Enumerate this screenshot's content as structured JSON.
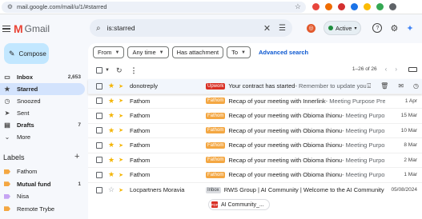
{
  "browser": {
    "url": "mail.google.com/mail/u/1/#starred",
    "ext_colors": [
      "#e8453c",
      "#ef6c00",
      "#d32f2f",
      "#1a73e8",
      "#fbbc04",
      "#34a853",
      "#5f6368"
    ]
  },
  "header": {
    "app_name": "Gmail",
    "search_query": "is:starred",
    "status_label": "Active"
  },
  "sidebar": {
    "compose_label": "Compose",
    "items": [
      {
        "label": "Inbox",
        "count": "2,653",
        "icon": "inbox-icon",
        "bold": true
      },
      {
        "label": "Starred",
        "count": "",
        "icon": "star-icon",
        "active": true
      },
      {
        "label": "Snoozed",
        "count": "",
        "icon": "clock-icon"
      },
      {
        "label": "Sent",
        "count": "",
        "icon": "send-icon"
      },
      {
        "label": "Drafts",
        "count": "7",
        "icon": "draft-icon",
        "bold": true
      },
      {
        "label": "More",
        "count": "",
        "icon": "chevron-down-icon"
      }
    ],
    "labels_title": "Labels",
    "labels": [
      {
        "label": "Fathom",
        "count": "",
        "color": "#f4a742"
      },
      {
        "label": "Mutual fund",
        "count": "1",
        "color": "#f4a742",
        "bold": true
      },
      {
        "label": "Nisa",
        "count": "",
        "color": "#c6a4f3"
      },
      {
        "label": "Remote Trybe",
        "count": "",
        "color": "#f4a742"
      }
    ]
  },
  "filters": {
    "from": "From",
    "any_time": "Any time",
    "has_attachment": "Has attachment",
    "to": "To",
    "advanced": "Advanced search"
  },
  "pagination": "1–26 of 26",
  "emails": [
    {
      "sender": "donotreply",
      "tag": "Upwork",
      "subject": "Your contract has started",
      "snippet": " - Remember to update you...",
      "date": ""
    },
    {
      "sender": "Fathom",
      "tag": "Fathom",
      "subject": "Recap of your meeting with Innerlink",
      "snippet": " - Meeting Purpose Pre-qu...",
      "date": "1 Apr"
    },
    {
      "sender": "Fathom",
      "tag": "Fathom",
      "subject": "Recap of your meeting with Obioma Ihionu",
      "snippet": " - Meeting Purpose Ses...",
      "date": "15 Mar"
    },
    {
      "sender": "Fathom",
      "tag": "Fathom",
      "subject": "Recap of your meeting with Obioma Ihionu",
      "snippet": " - Meeting Purpose Ses...",
      "date": "10 Mar"
    },
    {
      "sender": "Fathom",
      "tag": "Fathom",
      "subject": "Recap of your meeting with Obioma Ihionu",
      "snippet": " - Meeting Purpose Ses...",
      "date": "8 Mar"
    },
    {
      "sender": "Fathom",
      "tag": "Fathom",
      "subject": "Recap of your meeting with Obioma Ihionu",
      "snippet": " - Meeting Purpose Ses...",
      "date": "2 Mar"
    },
    {
      "sender": "Fathom",
      "tag": "Fathom",
      "subject": "Recap of your meeting with Obioma Ihionu",
      "snippet": " - Meeting Purpose Ses...",
      "date": "1 Mar"
    },
    {
      "sender": "Locpartners Moravia",
      "tag": "Inbox",
      "subject": "RWS Group | AI Community | Welcome to the AI Community RW...",
      "snippet": "",
      "date": "05/08/2024"
    }
  ],
  "attachment": "AI Community_..."
}
